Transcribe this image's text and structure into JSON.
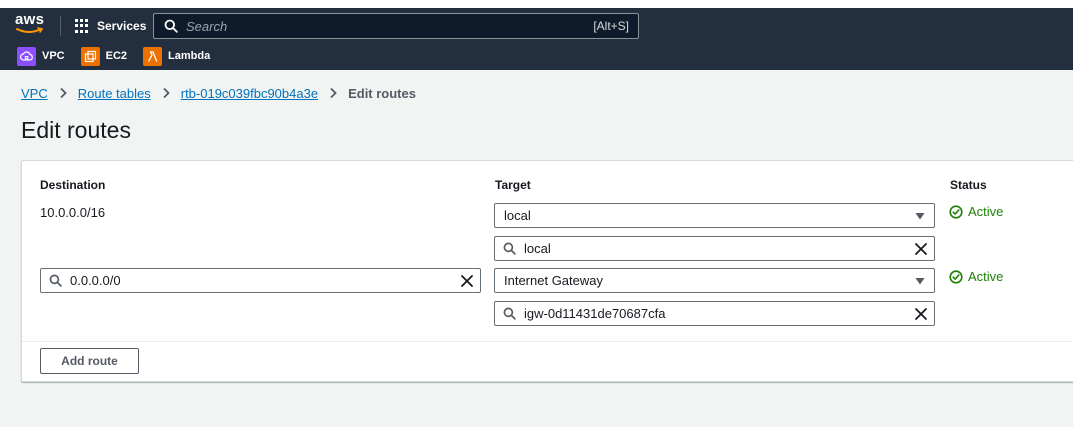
{
  "nav": {
    "logo_text": "aws",
    "services_label": "Services",
    "search_placeholder": "Search",
    "search_shortcut": "[Alt+S]",
    "favorites": [
      {
        "label": "VPC",
        "icon": "vpc-icon",
        "color": "#8c4fff"
      },
      {
        "label": "EC2",
        "icon": "ec2-icon",
        "color": "#ed7100"
      },
      {
        "label": "Lambda",
        "icon": "lambda-icon",
        "color": "#ed7100"
      }
    ],
    "background": "#232f3e"
  },
  "breadcrumb": {
    "items": [
      "VPC",
      "Route tables",
      "rtb-019c039fbc90b4a3e"
    ],
    "current": "Edit routes"
  },
  "page": {
    "title": "Edit routes"
  },
  "routes_table": {
    "headers": {
      "destination": "Destination",
      "target": "Target",
      "status": "Status"
    },
    "rows": [
      {
        "destination": "10.0.0.0/16",
        "destination_editable": false,
        "target_type": "local",
        "target_value": "local",
        "status": "Active"
      },
      {
        "destination": "0.0.0.0/0",
        "destination_editable": true,
        "target_type": "Internet Gateway",
        "target_value": "igw-0d11431de70687cfa",
        "status": "Active"
      }
    ],
    "add_route_label": "Add route"
  },
  "colors": {
    "link": "#0073bb",
    "success": "#1d8102",
    "background": "#f2f3f3"
  }
}
